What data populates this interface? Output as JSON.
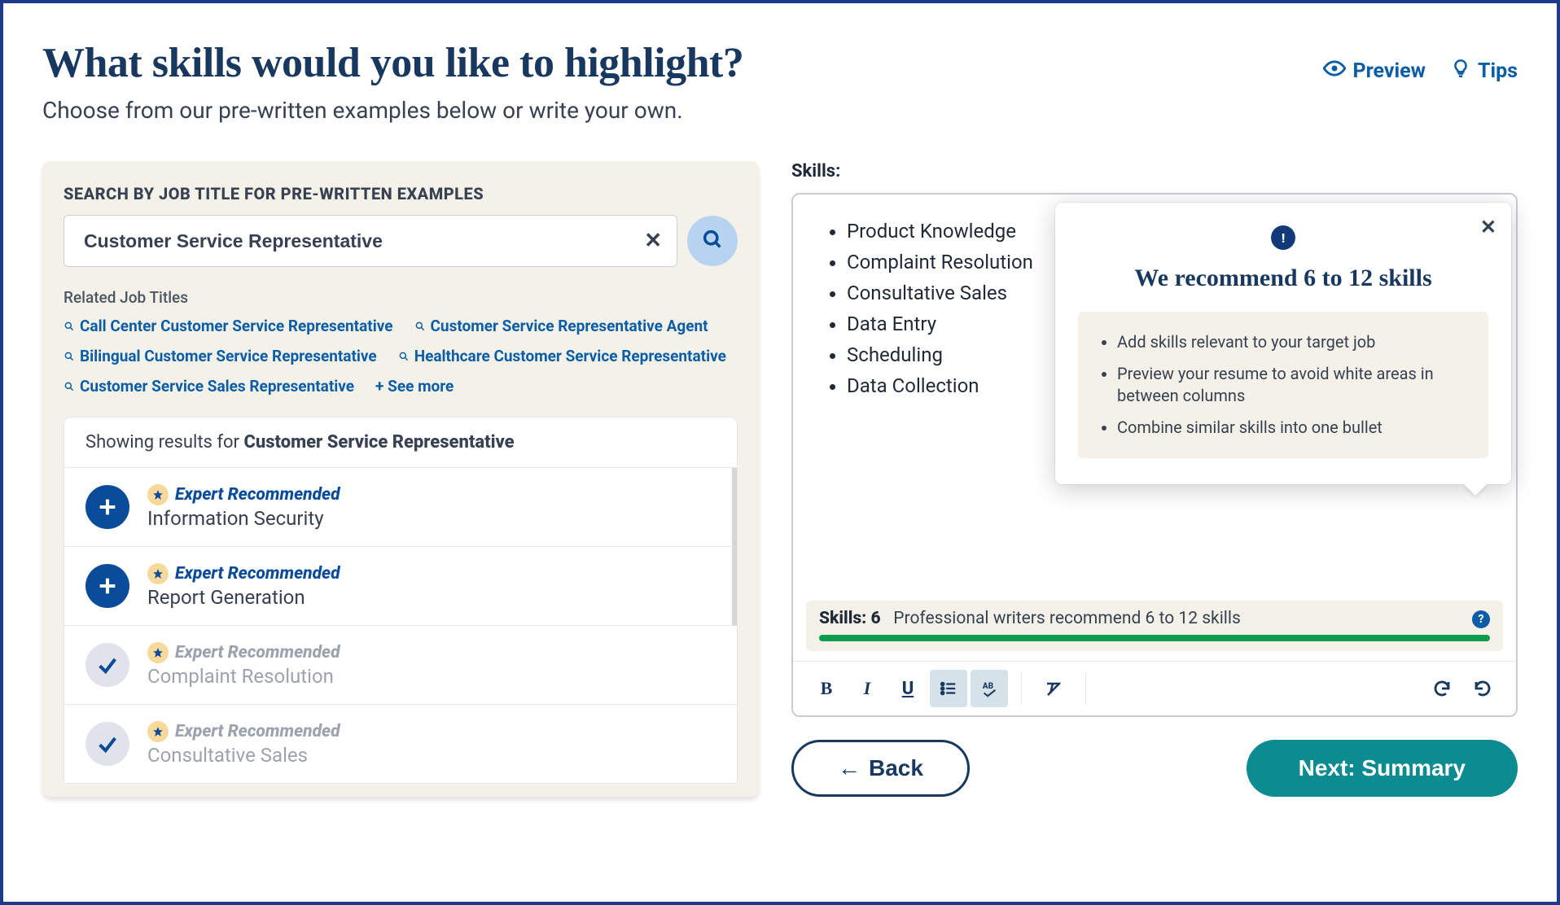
{
  "header": {
    "title": "What skills would you like to highlight?",
    "subtitle": "Choose from our pre-written examples below or write your own.",
    "preview": "Preview",
    "tips": "Tips"
  },
  "search": {
    "label": "SEARCH BY JOB TITLE FOR PRE-WRITTEN EXAMPLES",
    "value": "Customer Service Representative",
    "related_label": "Related Job Titles",
    "see_more": "+ See more"
  },
  "related": [
    "Call Center Customer Service Representative",
    "Customer Service Representative Agent",
    "Bilingual Customer Service Representative",
    "Healthcare Customer Service Representative",
    "Customer Service Sales Representative"
  ],
  "results": {
    "showing_prefix": "Showing results for ",
    "showing_term": "Customer Service Representative",
    "expert_label": "Expert Recommended",
    "items": [
      {
        "title": "Information Security",
        "added": false
      },
      {
        "title": "Report Generation",
        "added": false
      },
      {
        "title": "Complaint Resolution",
        "added": true
      },
      {
        "title": "Consultative Sales",
        "added": true
      }
    ]
  },
  "skills": {
    "label": "Skills:",
    "items": [
      "Product Knowledge",
      "Complaint Resolution",
      "Consultative Sales",
      "Data Entry",
      "Scheduling",
      "Data Collection"
    ],
    "status_label": "Skills:",
    "count": "6",
    "status_msg": "Professional writers recommend 6 to 12 skills"
  },
  "popover": {
    "title": "We recommend 6 to 12 skills",
    "tips": [
      "Add skills relevant to your target job",
      "Preview your resume to avoid white areas in between columns",
      "Combine similar skills into one bullet"
    ]
  },
  "nav": {
    "back": "Back",
    "next": "Next: Summary"
  }
}
